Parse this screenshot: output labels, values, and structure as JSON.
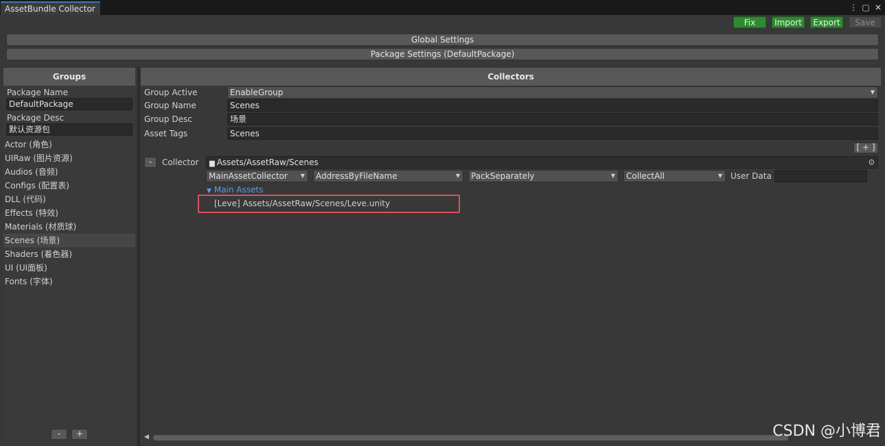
{
  "window": {
    "tab_title": "AssetBundle Collector",
    "menu_icon": "kebab-icon",
    "maximize_icon": "maximize-icon",
    "close_icon": "close-icon"
  },
  "toolbar": {
    "fix": "Fix",
    "import": "Import",
    "export": "Export",
    "save": "Save"
  },
  "global_settings": "Global Settings",
  "package_settings": "Package Settings (DefaultPackage)",
  "groups": {
    "header": "Groups",
    "package_name_label": "Package Name",
    "package_name_value": "DefaultPackage",
    "package_desc_label": "Package Desc",
    "package_desc_value": "默认资源包",
    "items": [
      "Actor (角色)",
      "UIRaw (图片资源)",
      "Audios (音频)",
      "Configs (配置表)",
      "DLL (代码)",
      "Effects (特效)",
      "Materials (材质球)",
      "Scenes (场景)",
      "Shaders (着色器)",
      "UI (UI面板)",
      "Fonts (字体)"
    ],
    "selected": "Scenes (场景)",
    "remove_button": "-",
    "add_button": "+"
  },
  "collectors": {
    "header": "Collectors",
    "group_active_label": "Group Active",
    "group_active_value": "EnableGroup",
    "group_name_label": "Group Name",
    "group_name_value": "Scenes",
    "group_desc_label": "Group Desc",
    "group_desc_value": "场景",
    "asset_tags_label": "Asset Tags",
    "asset_tags_value": "Scenes",
    "add_collector_button": "[ + ]",
    "remove_collector_button": "-",
    "collector_label": "Collector",
    "collector_path": "Assets/AssetRaw/Scenes",
    "collector_type": "MainAssetCollector",
    "address_rule": "AddressByFileName",
    "pack_rule": "PackSeparately",
    "filter_rule": "CollectAll",
    "user_data_label": "User Data",
    "user_data_value": "",
    "main_assets_label": "Main Assets",
    "main_assets": [
      "[Leve] Assets/AssetRaw/Scenes/Leve.unity"
    ]
  },
  "watermark": "CSDN @小博君",
  "colors": {
    "accent_green": "#2f8a2f",
    "foldout_blue": "#5c9ded",
    "highlight_red": "#e0505a",
    "tab_accent": "#3a79bb"
  }
}
